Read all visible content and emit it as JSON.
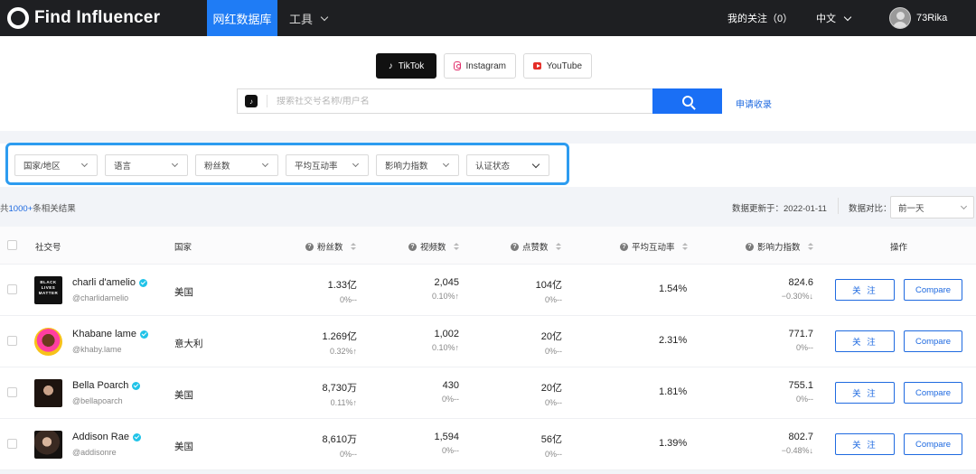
{
  "nav": {
    "logo_text": "Find Influencer",
    "active_tab": "网红数据库",
    "tools": "工具",
    "my_follows": "我的关注（0）",
    "language": "中文",
    "username": "73Rika"
  },
  "platforms": [
    {
      "label": "TikTok",
      "icon": "tiktok-icon",
      "active": true
    },
    {
      "label": "Instagram",
      "icon": "instagram-icon",
      "active": false
    },
    {
      "label": "YouTube",
      "icon": "youtube-icon",
      "active": false
    }
  ],
  "search": {
    "placeholder": "搜索社交号名称/用户名",
    "apply_link": "申请收录"
  },
  "filters": [
    "国家/地区",
    "语言",
    "粉丝数",
    "平均互动率",
    "影响力指数",
    "认证状态"
  ],
  "results": {
    "prefix": "共",
    "count": "1000+",
    "suffix": "条相关结果",
    "updated_label": "数据更新于：2022-01-11",
    "compare_label": "数据对比：",
    "compare_value": "前一天"
  },
  "table": {
    "headers": {
      "account": "社交号",
      "country": "国家",
      "followers": "粉丝数",
      "videos": "视频数",
      "likes": "点赞数",
      "engagement": "平均互动率",
      "influence": "影响力指数",
      "actions": "操作"
    },
    "follow_label": "关 注",
    "compare_label": "Compare",
    "rows": [
      {
        "name": "charli d'amelio",
        "handle": "@charlidamelio",
        "country": "美国",
        "followers": "1.33亿",
        "followers_change": "0%--",
        "videos": "2,045",
        "videos_change": "0.10%↑",
        "likes": "104亿",
        "likes_change": "0%--",
        "engagement": "1.54%",
        "influence": "824.6",
        "influence_change": "−0.30%↓"
      },
      {
        "name": "Khabane lame",
        "handle": "@khaby.lame",
        "country": "意大利",
        "followers": "1.269亿",
        "followers_change": "0.32%↑",
        "videos": "1,002",
        "videos_change": "0.10%↑",
        "likes": "20亿",
        "likes_change": "0%--",
        "engagement": "2.31%",
        "influence": "771.7",
        "influence_change": "0%--"
      },
      {
        "name": "Bella Poarch",
        "handle": "@bellapoarch",
        "country": "美国",
        "followers": "8,730万",
        "followers_change": "0.11%↑",
        "videos": "430",
        "videos_change": "0%--",
        "likes": "20亿",
        "likes_change": "0%--",
        "engagement": "1.81%",
        "influence": "755.1",
        "influence_change": "0%--"
      },
      {
        "name": "Addison Rae",
        "handle": "@addisonre",
        "country": "美国",
        "followers": "8,610万",
        "followers_change": "0%--",
        "videos": "1,594",
        "videos_change": "0%--",
        "likes": "56亿",
        "likes_change": "0%--",
        "engagement": "1.39%",
        "influence": "802.7",
        "influence_change": "−0.48%↓"
      }
    ],
    "blm_avatar_text": "BLACK LIVES MATTER"
  },
  "colors": {
    "nav_bg": "#1e1f22",
    "accent": "#1f7cf5",
    "filter_highlight": "#2d9cf0",
    "up": "#29b34b",
    "down": "#e0453b"
  }
}
